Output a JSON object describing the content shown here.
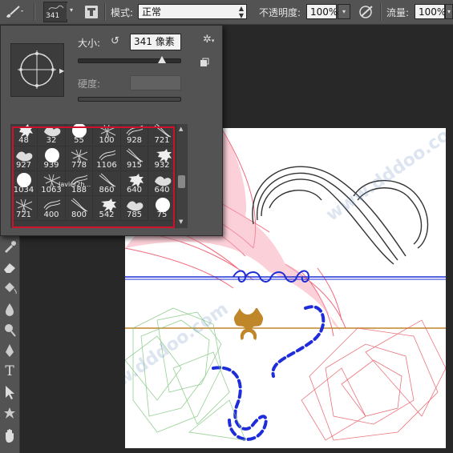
{
  "options_bar": {
    "brush_size": "341",
    "mode_label": "模式:",
    "mode_value": "正常",
    "opacity_label": "不透明度:",
    "opacity_value": "100%",
    "flow_label": "流量:",
    "flow_value": "100%"
  },
  "brush_panel": {
    "size_label": "大小:",
    "size_value": "341 像素",
    "hardness_label": "硬度:",
    "brush_presets": [
      {
        "size": "48"
      },
      {
        "size": "32"
      },
      {
        "size": "55"
      },
      {
        "size": "100"
      },
      {
        "size": "928"
      },
      {
        "size": "721"
      },
      {
        "size": "927"
      },
      {
        "size": "939"
      },
      {
        "size": "778"
      },
      {
        "size": "1106"
      },
      {
        "size": "915"
      },
      {
        "size": "932"
      },
      {
        "size": "1034"
      },
      {
        "size": "1063"
      },
      {
        "size": "188"
      },
      {
        "size": "860"
      },
      {
        "size": "640"
      },
      {
        "size": "640"
      },
      {
        "size": "721"
      },
      {
        "size": "400"
      },
      {
        "size": "800"
      },
      {
        "size": "542"
      },
      {
        "size": "785"
      },
      {
        "size": "75"
      }
    ],
    "preview_signature": "Javier2h..."
  },
  "watermark": "www.dddoo.com",
  "colors": {
    "selection": "#d0112b",
    "guide_blue": "#1f2fd6",
    "guide_gold": "#c0862a"
  }
}
